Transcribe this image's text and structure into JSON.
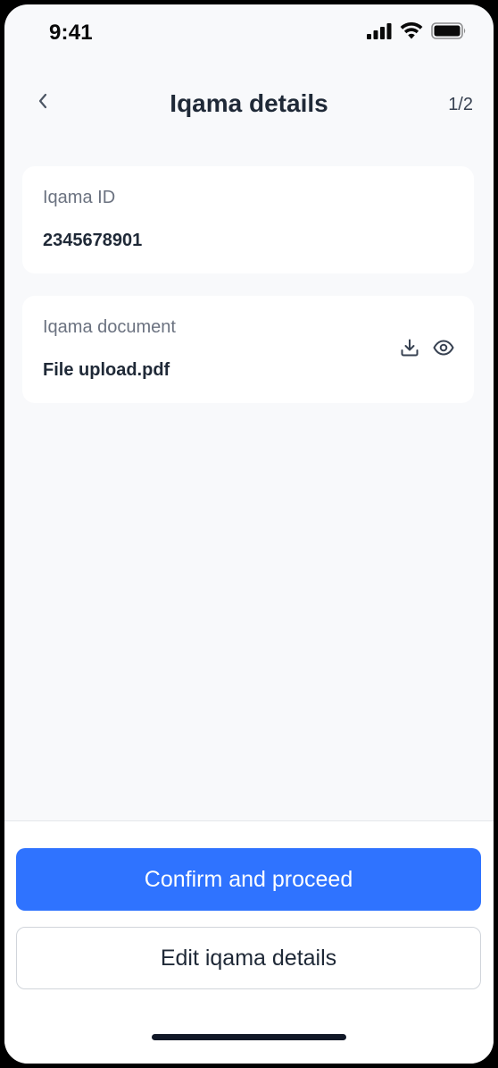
{
  "status_bar": {
    "time": "9:41",
    "icons": [
      "cellular-signal-icon",
      "wifi-icon",
      "battery-icon"
    ]
  },
  "header": {
    "back_icon": "chevron-left-icon",
    "title": "Iqama details",
    "step": "1/2"
  },
  "cards": {
    "iqama_id": {
      "label": "Iqama ID",
      "value": "2345678901"
    },
    "iqama_document": {
      "label": "Iqama document",
      "value": "File upload.pdf",
      "actions": [
        "download-icon",
        "eye-icon"
      ]
    }
  },
  "footer": {
    "confirm_label": "Confirm and proceed",
    "edit_label": "Edit iqama details"
  },
  "colors": {
    "primary": "#2f73ff",
    "background": "#f8f9fb",
    "card": "#ffffff",
    "text_primary": "#1f2937",
    "text_secondary": "#6b7280"
  }
}
